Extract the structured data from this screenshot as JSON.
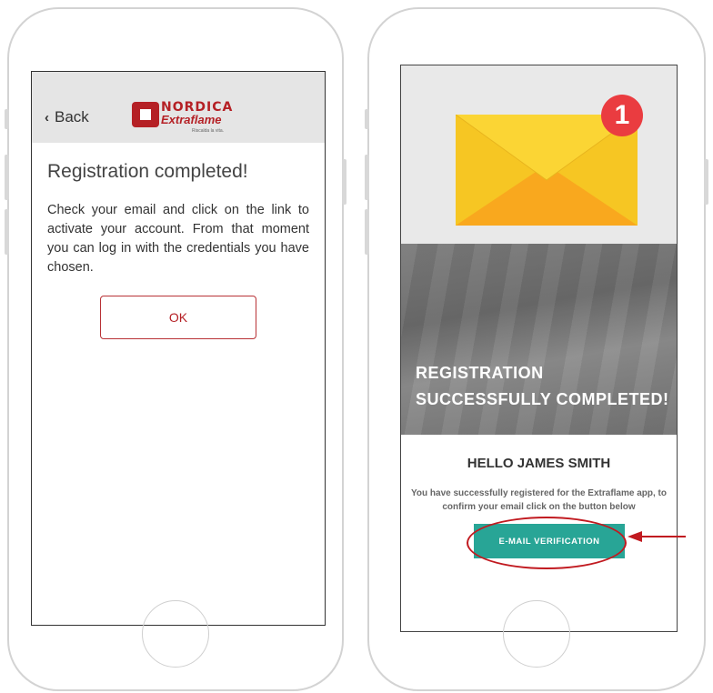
{
  "left_phone": {
    "back_label": "Back",
    "logo": {
      "brand_top": "NORDICA",
      "brand_bottom": "Extraflame",
      "tagline": "Riscalda la vita."
    },
    "title": "Registration completed!",
    "message": "Check your email and click on the link to activate your account. From that moment you can log in with the credentials you have chosen.",
    "ok_label": "OK"
  },
  "right_phone": {
    "notification_count": "1",
    "banner_line1": "REGISTRATION",
    "banner_line2": "SUCCESSFULLY COMPLETED!",
    "greeting": "HELLO JAMES SMITH",
    "description": "You have successfully registered for the Extraflame app, to confirm your email click on the button below",
    "verify_label": "E-MAIL VERIFICATION"
  },
  "colors": {
    "brand_red": "#b52025",
    "teal": "#28a596",
    "envelope": "#f6c623",
    "badge": "#ea3c40"
  }
}
